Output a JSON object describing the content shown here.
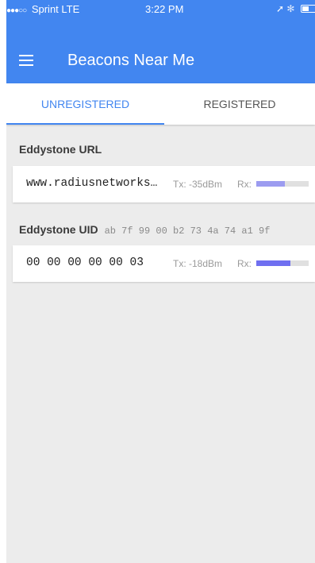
{
  "status_bar": {
    "signal_dots": "●●●○○",
    "carrier": "Sprint",
    "network": "LTE",
    "time": "3:22 PM",
    "icons": [
      "location-arrow-icon",
      "bluetooth-icon",
      "battery-icon"
    ],
    "battery_level": 0.3
  },
  "app_bar": {
    "menu_icon": "menu-icon",
    "title": "Beacons Near Me",
    "color": "#4286f0"
  },
  "tabs": [
    {
      "label": "UNREGISTERED",
      "selected": true
    },
    {
      "label": "REGISTERED",
      "selected": false
    }
  ],
  "sections": [
    {
      "header": "Eddystone URL",
      "header_detail": "",
      "beacon": {
        "value": "www.radiusnetworks…",
        "tx": "Tx: -35dBm",
        "rx_label": "Rx:",
        "rx_level": 0.55,
        "rx_color": "#9c9cf0"
      }
    },
    {
      "header": "Eddystone UID",
      "header_detail": "ab 7f 99 00 b2 73 4a 74 a1 9f",
      "beacon": {
        "value": "00 00 00 00 00 03",
        "tx": "Tx: -18dBm",
        "rx_label": "Rx:",
        "rx_level": 0.65,
        "rx_color": "#6f6ff0"
      }
    }
  ]
}
